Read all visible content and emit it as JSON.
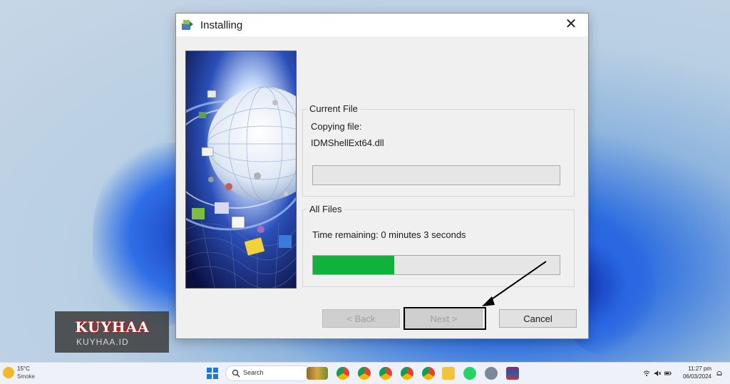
{
  "dialog": {
    "title": "Installing",
    "close_glyph": "✕",
    "current_file": {
      "legend": "Current File",
      "label": "Copying file:",
      "filename": "IDMShellExt64.dll",
      "progress": 0
    },
    "all_files": {
      "legend": "All Files",
      "time_remaining": "Time remaining: 0 minutes 3 seconds",
      "progress": 0.33,
      "progress_color": "#0fb23a"
    },
    "buttons": {
      "back": "< Back",
      "next": "Next >",
      "cancel": "Cancel"
    }
  },
  "watermark": {
    "title": "KUYHAA",
    "subtitle": "KUYHAA.ID"
  },
  "taskbar": {
    "weather": {
      "temp": "15°C",
      "condition": "Smoke"
    },
    "search_placeholder": "Search",
    "apps": [
      "widgets-icon",
      "chrome-icon",
      "chrome-icon",
      "chrome-icon",
      "chrome-icon",
      "chrome-icon",
      "file-explorer-icon",
      "whatsapp-icon",
      "settings-icon",
      "winrar-icon"
    ],
    "clock": {
      "time": "11:27 pm",
      "date": "06/03/2024"
    }
  }
}
